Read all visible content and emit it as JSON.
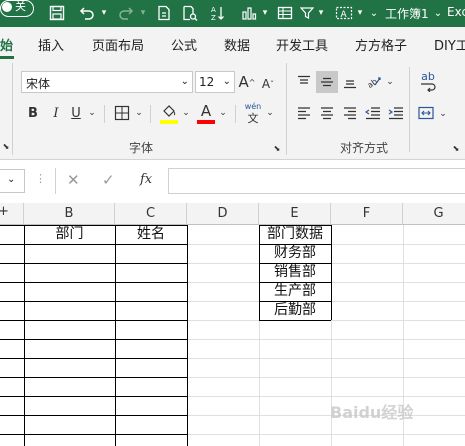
{
  "titlebar": {
    "autosave_label": "关",
    "doc_title": "工作簿1",
    "app_name": "Exc"
  },
  "tabs": [
    "始",
    "插入",
    "页面布局",
    "公式",
    "数据",
    "开发工具",
    "方方格子",
    "DIY工"
  ],
  "ribbon": {
    "font_name": "宋体",
    "font_size": "12",
    "grow_font": "A",
    "shrink_font": "A",
    "bold": "B",
    "italic": "I",
    "underline": "U",
    "phonetic": "wén",
    "phonetic_sub": "文",
    "wrap_icon_text": "ab",
    "font_group_label": "字体",
    "align_group_label": "对齐方式",
    "fill_color": "#ffff00",
    "font_color": "#ff0000"
  },
  "formula": {
    "fx": "fx",
    "value": ""
  },
  "columns": [
    "B",
    "C",
    "D",
    "E",
    "F",
    "G"
  ],
  "cells": {
    "B1": "部门",
    "C1": "姓名",
    "E1": "部门数据",
    "E2": "财务部",
    "E3": "销售部",
    "E4": "生产部",
    "E5": "后勤部"
  },
  "watermark": "Baidu经验"
}
